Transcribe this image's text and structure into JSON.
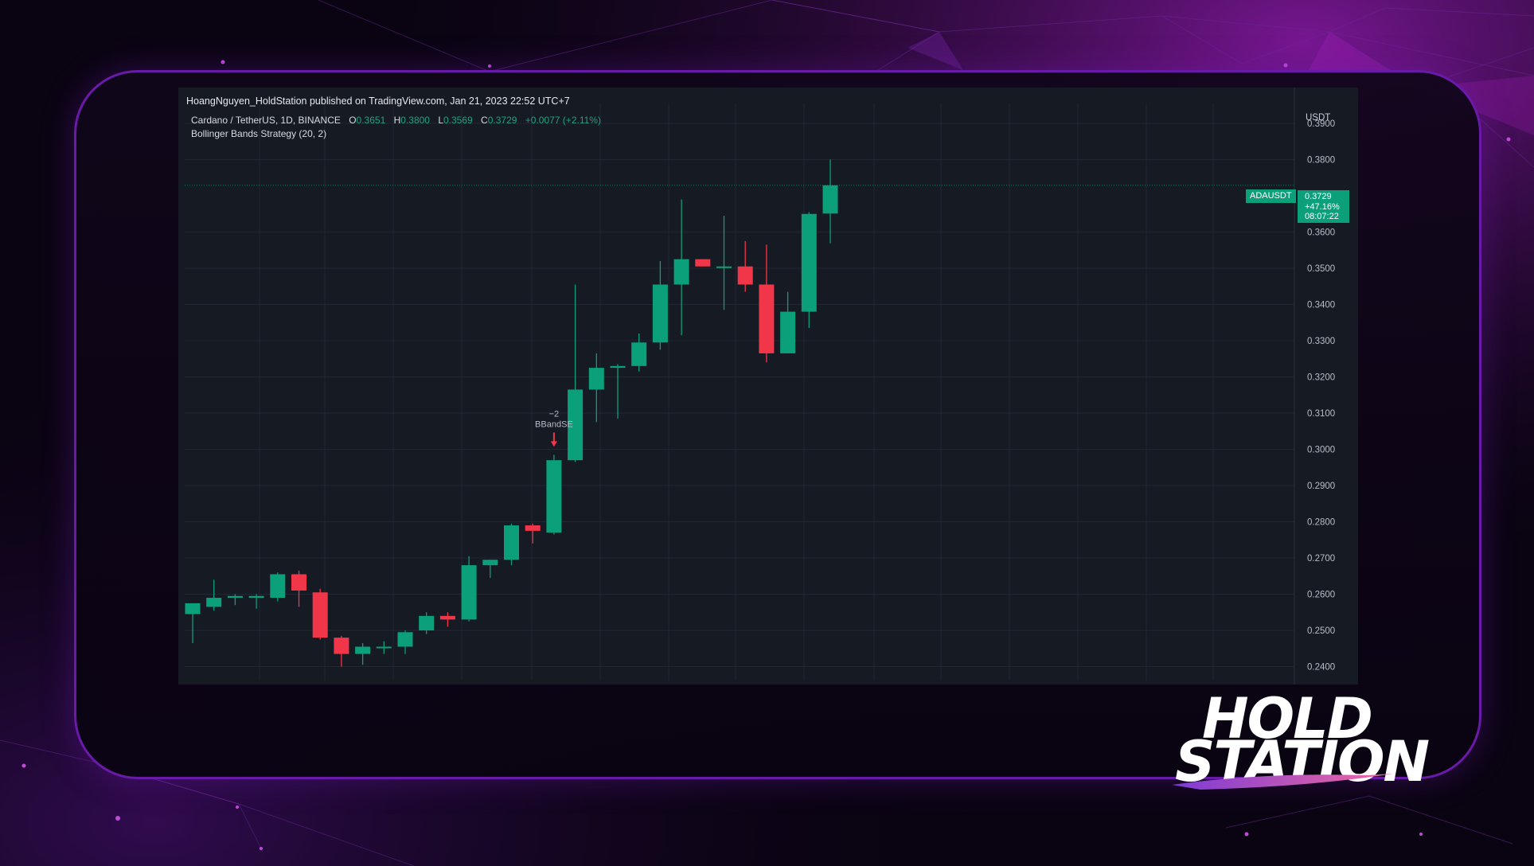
{
  "publish_line": "HoangNguyen_HoldStation published on TradingView.com, Jan 21, 2023 22:52 UTC+7",
  "symbol_line": {
    "name": "Cardano / TetherUS, 1D, BINANCE",
    "o_label": "O",
    "o_value": "0.3651",
    "h_label": "H",
    "h_value": "0.3800",
    "l_label": "L",
    "l_value": "0.3569",
    "c_label": "C",
    "c_value": "0.3729",
    "change": "+0.0077 (+2.11%)"
  },
  "indicator_line": "Bollinger Bands Strategy (20, 2)",
  "currency": "USDT",
  "price_tag": {
    "symbol": "ADAUSDT",
    "price": "0.3729",
    "change": "+47.16%",
    "countdown": "08:07:22"
  },
  "signal": {
    "qty": "−2",
    "label": "BBandSE",
    "candle_index": 17
  },
  "logo": {
    "line1": "HOLD",
    "line2": "STATION"
  },
  "colors": {
    "up": "#0b9f7a",
    "down": "#f2364a",
    "background": "#161a23",
    "grid": "#232734",
    "brand_purple": "#7b1fc4"
  },
  "chart_data": {
    "type": "candlestick",
    "y_ticks": [
      "0.3900",
      "0.3800",
      "0.3600",
      "0.3500",
      "0.3400",
      "0.3300",
      "0.3200",
      "0.3100",
      "0.3000",
      "0.2900",
      "0.2800",
      "0.2700",
      "0.2600",
      "0.2500",
      "0.2400"
    ],
    "ylim": [
      0.2395,
      0.3915
    ],
    "candles": [
      {
        "o": 0.2545,
        "h": 0.2575,
        "l": 0.2465,
        "c": 0.2575
      },
      {
        "o": 0.2565,
        "h": 0.264,
        "l": 0.2555,
        "c": 0.259
      },
      {
        "o": 0.259,
        "h": 0.26,
        "l": 0.257,
        "c": 0.2595
      },
      {
        "o": 0.259,
        "h": 0.26,
        "l": 0.256,
        "c": 0.2595
      },
      {
        "o": 0.259,
        "h": 0.266,
        "l": 0.258,
        "c": 0.2655
      },
      {
        "o": 0.2655,
        "h": 0.2665,
        "l": 0.2565,
        "c": 0.261
      },
      {
        "o": 0.2605,
        "h": 0.2615,
        "l": 0.2475,
        "c": 0.248
      },
      {
        "o": 0.248,
        "h": 0.2485,
        "l": 0.24,
        "c": 0.2435
      },
      {
        "o": 0.2435,
        "h": 0.2465,
        "l": 0.2405,
        "c": 0.2455
      },
      {
        "o": 0.2455,
        "h": 0.247,
        "l": 0.2435,
        "c": 0.2455
      },
      {
        "o": 0.2455,
        "h": 0.25,
        "l": 0.2435,
        "c": 0.2495
      },
      {
        "o": 0.25,
        "h": 0.255,
        "l": 0.249,
        "c": 0.254
      },
      {
        "o": 0.254,
        "h": 0.255,
        "l": 0.251,
        "c": 0.253
      },
      {
        "o": 0.253,
        "h": 0.2705,
        "l": 0.2525,
        "c": 0.268
      },
      {
        "o": 0.268,
        "h": 0.2695,
        "l": 0.2645,
        "c": 0.2695
      },
      {
        "o": 0.2695,
        "h": 0.2795,
        "l": 0.268,
        "c": 0.279
      },
      {
        "o": 0.279,
        "h": 0.2795,
        "l": 0.274,
        "c": 0.2775
      },
      {
        "o": 0.277,
        "h": 0.2985,
        "l": 0.2765,
        "c": 0.297
      },
      {
        "o": 0.297,
        "h": 0.3455,
        "l": 0.2965,
        "c": 0.3165
      },
      {
        "o": 0.3165,
        "h": 0.3265,
        "l": 0.3075,
        "c": 0.3225
      },
      {
        "o": 0.3225,
        "h": 0.3235,
        "l": 0.3085,
        "c": 0.323
      },
      {
        "o": 0.323,
        "h": 0.332,
        "l": 0.3215,
        "c": 0.3295
      },
      {
        "o": 0.3295,
        "h": 0.352,
        "l": 0.3275,
        "c": 0.3455
      },
      {
        "o": 0.3455,
        "h": 0.369,
        "l": 0.3315,
        "c": 0.3525
      },
      {
        "o": 0.3525,
        "h": 0.3525,
        "l": 0.3505,
        "c": 0.3505
      },
      {
        "o": 0.3505,
        "h": 0.3645,
        "l": 0.3385,
        "c": 0.3505
      },
      {
        "o": 0.3505,
        "h": 0.3575,
        "l": 0.3435,
        "c": 0.3455
      },
      {
        "o": 0.3455,
        "h": 0.3565,
        "l": 0.324,
        "c": 0.3265
      },
      {
        "o": 0.3265,
        "h": 0.3435,
        "l": 0.3265,
        "c": 0.338
      },
      {
        "o": 0.338,
        "h": 0.3655,
        "l": 0.3335,
        "c": 0.365
      },
      {
        "o": 0.3651,
        "h": 0.38,
        "l": 0.3569,
        "c": 0.3729
      }
    ],
    "last_price": 0.3729
  }
}
